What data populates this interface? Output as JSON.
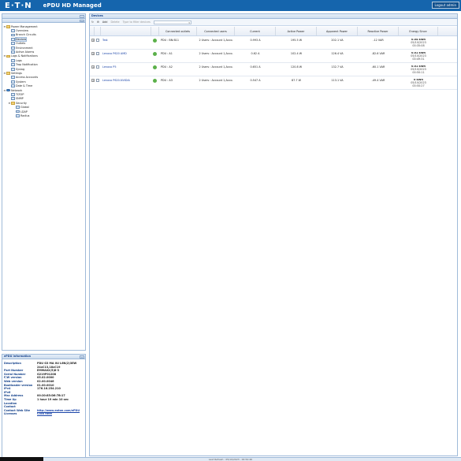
{
  "app": {
    "logo": "E·T·N",
    "title": "ePDU HD Managed",
    "logout_label": "Logout admin"
  },
  "tree": [
    {
      "label": "Power Management",
      "level": 0,
      "toggle": "⊟",
      "icon": "folder",
      "selected": false
    },
    {
      "label": "Overview",
      "level": 1,
      "toggle": "",
      "icon": "page",
      "selected": false
    },
    {
      "label": "Branch Circuits",
      "level": 1,
      "toggle": "",
      "icon": "page",
      "selected": false
    },
    {
      "label": "Devices",
      "level": 1,
      "toggle": "",
      "icon": "page",
      "selected": true
    },
    {
      "label": "Outlets",
      "level": 1,
      "toggle": "",
      "icon": "page",
      "selected": false
    },
    {
      "label": "Environment",
      "level": 1,
      "toggle": "",
      "icon": "page",
      "selected": false
    },
    {
      "label": "Active Alarms",
      "level": 1,
      "toggle": "",
      "icon": "page",
      "selected": false
    },
    {
      "label": "Logs & Notifications",
      "level": 0,
      "toggle": "⊟",
      "icon": "folder",
      "selected": false
    },
    {
      "label": "Logs",
      "level": 1,
      "toggle": "",
      "icon": "page",
      "selected": false
    },
    {
      "label": "Trap Notification",
      "level": 1,
      "toggle": "",
      "icon": "page",
      "selected": false
    },
    {
      "label": "Syslog",
      "level": 1,
      "toggle": "",
      "icon": "page",
      "selected": false
    },
    {
      "label": "Settings",
      "level": 0,
      "toggle": "⊟",
      "icon": "folder",
      "selected": false
    },
    {
      "label": "Access Accounts",
      "level": 1,
      "toggle": "",
      "icon": "page",
      "selected": false
    },
    {
      "label": "System",
      "level": 1,
      "toggle": "",
      "icon": "page",
      "selected": false
    },
    {
      "label": "Date & Time",
      "level": 1,
      "toggle": "",
      "icon": "page",
      "selected": false
    },
    {
      "label": "Network",
      "level": 0,
      "toggle": "⊟",
      "icon": "globe",
      "selected": false
    },
    {
      "label": "TCP/IP",
      "level": 1,
      "toggle": "",
      "icon": "page",
      "selected": false
    },
    {
      "label": "SNMP",
      "level": 1,
      "toggle": "",
      "icon": "page",
      "selected": false
    },
    {
      "label": "Security",
      "level": 1,
      "toggle": "⊟",
      "icon": "folder",
      "selected": false
    },
    {
      "label": "Global",
      "level": 2,
      "toggle": "",
      "icon": "page",
      "selected": false
    },
    {
      "label": "LDAP",
      "level": 2,
      "toggle": "",
      "icon": "page",
      "selected": false
    },
    {
      "label": "Radius",
      "level": 2,
      "toggle": "",
      "icon": "page",
      "selected": false
    }
  ],
  "info": {
    "title": "ePDU Information",
    "rows": [
      {
        "key": "Description",
        "value": "PDU G3 MA 0U L6N(2)3EW 24xC13,18xC19",
        "link": false
      },
      {
        "key": "Part Number",
        "value": "EMMA02(5)8-3",
        "link": false
      },
      {
        "key": "Serial Number",
        "value": "G219P01208",
        "link": false
      },
      {
        "key": "F/W version",
        "value": "05.02.0000",
        "link": false
      },
      {
        "key": "Web version",
        "value": "02.00.0046",
        "link": false
      },
      {
        "key": "Bootloader version",
        "value": "01.00.0010",
        "link": false
      },
      {
        "key": "IPv4",
        "value": "176.16.254.210",
        "link": false
      },
      {
        "key": "IPv6",
        "value": "",
        "link": false
      },
      {
        "key": "Mac Address",
        "value": "00:20:85:D6:7B:17",
        "link": false
      },
      {
        "key": "Time Up",
        "value": "1 hour 19 min 10 sec",
        "link": false
      },
      {
        "key": "Location",
        "value": "",
        "link": false
      },
      {
        "key": "Contact",
        "value": "",
        "link": false
      },
      {
        "key": "Contact Web Site",
        "value": "http://www.eaton.com/ePDU",
        "link": true
      },
      {
        "key": "Licenses",
        "value": "Click here",
        "link": true
      }
    ]
  },
  "main": {
    "title": "Devices",
    "toolbar": {
      "add": "Add",
      "delete": "Delete",
      "select_placeholder": "Type to filter devices"
    },
    "columns": [
      "Connected outlets",
      "Connected users",
      "Current",
      "Active Power",
      "Apparent Power",
      "Reactive Power",
      "Energy Since"
    ],
    "rows": [
      {
        "name": "Test",
        "outlet": "PDU : BN:B11",
        "users": "2 Users : Account 1,Acco.",
        "current": "0.993 A",
        "active": "195.5 W",
        "apparent": "202.1 VA",
        "reactive": "-12 VAR",
        "energy": "0.04 kWh",
        "date": "05/10/2023",
        "time": "00:35:08"
      },
      {
        "name": "Lenovo P620 AMD",
        "outlet": "PDU : A1",
        "users": "2 Users : Account 1,Acco.",
        "current": "0.62 A",
        "active": "102.4 W",
        "apparent": "126.4 VA",
        "reactive": "-82.6 VAR",
        "energy": "0.01 kWh",
        "date": "05/10/2023",
        "time": "00:49:31"
      },
      {
        "name": "Lenovo P5",
        "outlet": "PDU : A2",
        "users": "2 Users : Account 1,Acco.",
        "current": "0.651 A",
        "active": "120.8 W",
        "apparent": "132.7 VA",
        "reactive": "-60.1 VAR",
        "energy": "0.01 kWh",
        "date": "05/10/2023",
        "time": "00:50:11"
      },
      {
        "name": "Lenovo P620-NVIDIA",
        "outlet": "PDU : A3",
        "users": "2 Users : Account 1,Acco.",
        "current": "0.547 A",
        "active": "87.7 W",
        "apparent": "113.1 VA",
        "reactive": "-49.4 VAR",
        "energy": "0 kWh",
        "date": "05/10/2023",
        "time": "00:50:27"
      }
    ]
  },
  "footer": {
    "text": "Last Refresh : 05/10/2023 - 00:52:46"
  },
  "colors": {
    "header": "#1565ad",
    "accent": "#15428b",
    "status_ok": "#5bb04a"
  },
  "icons": [
    "collapse-icon",
    "folder-icon",
    "page-icon",
    "globe-icon",
    "status-ok-icon",
    "expand-row-icon",
    "refresh-icon"
  ]
}
